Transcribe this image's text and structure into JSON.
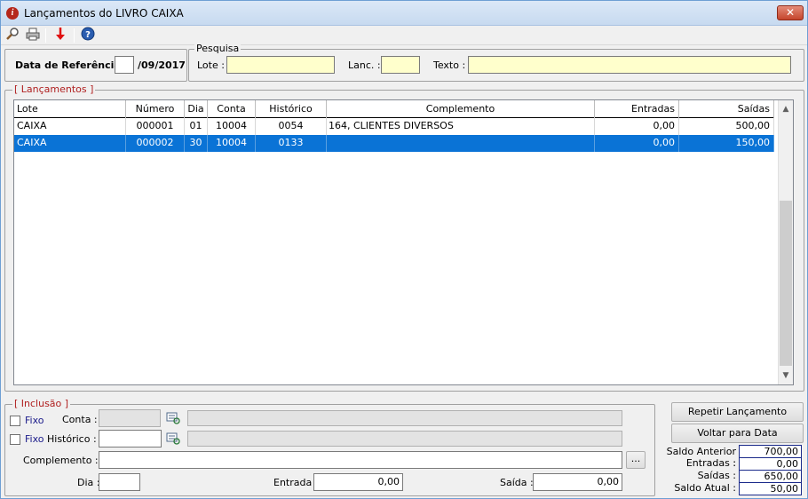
{
  "window": {
    "title": "Lançamentos do LIVRO CAIXA",
    "close_label": "✕"
  },
  "toolbar": {
    "icons": [
      "search-icon",
      "print-icon",
      "arrow-down-icon",
      "help-icon"
    ]
  },
  "ref": {
    "label": "Data de Referência :",
    "day_value": "",
    "month_year": "/09/2017"
  },
  "pesquisa": {
    "legend": "Pesquisa",
    "lote_label": "Lote :",
    "lote_value": "",
    "lanc_label": "Lanc. :",
    "lanc_value": "",
    "texto_label": "Texto :",
    "texto_value": ""
  },
  "lancamentos": {
    "legend": "[ Lançamentos ]",
    "columns": [
      "Lote",
      "Número",
      "Dia",
      "Conta",
      "Histórico",
      "Complemento",
      "Entradas",
      "Saídas"
    ],
    "rows": [
      [
        "CAIXA",
        "000001",
        "01",
        "10004",
        "0054",
        "164, CLIENTES DIVERSOS",
        "0,00",
        "500,00"
      ],
      [
        "CAIXA",
        "000002",
        "30",
        "10004",
        "0133",
        "",
        "0,00",
        "150,00"
      ]
    ]
  },
  "inclusao": {
    "legend": "[ Inclusão ]",
    "fixo1_label": "Fixo",
    "conta_label": "Conta :",
    "conta_value": "",
    "conta_desc": "",
    "fixo2_label": "Fixo",
    "historico_label": "Histórico :",
    "historico_value": "",
    "historico_desc": "",
    "complemento_label": "Complemento :",
    "complemento_value": "",
    "ellipsis_label": "...",
    "dia_label": "Dia :",
    "dia_value": "",
    "entrada_label": "Entrada :",
    "entrada_value": "0,00",
    "saida_label": "Saída :",
    "saida_value": "0,00"
  },
  "actions": {
    "repetir_label": "Repetir Lançamento",
    "voltar_label": "Voltar para Data"
  },
  "saldos": {
    "anterior_label": "Saldo Anterior :",
    "anterior_value": "700,00",
    "entradas_label": "Entradas :",
    "entradas_value": "0,00",
    "saidas_label": "Saídas :",
    "saidas_value": "650,00",
    "atual_label": "Saldo Atual :",
    "atual_value": "50,00"
  }
}
